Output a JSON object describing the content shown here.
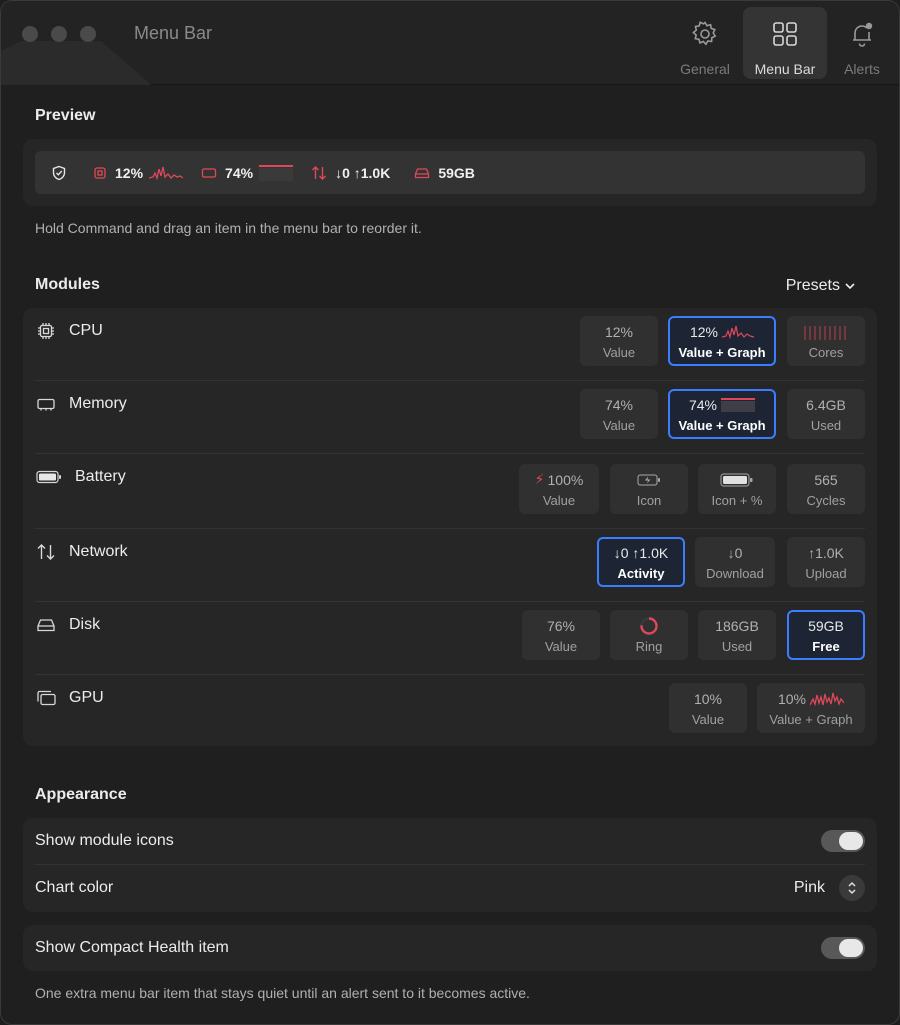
{
  "window": {
    "title": "Menu Bar"
  },
  "toolbar": {
    "tabs": [
      {
        "label": "General",
        "icon": "gear-icon"
      },
      {
        "label": "Menu Bar",
        "icon": "grid-icon",
        "active": true
      },
      {
        "label": "Alerts",
        "icon": "bell-icon"
      }
    ]
  },
  "preview": {
    "title": "Preview",
    "cpu": "12%",
    "memory": "74%",
    "network": "↓0 ↑1.0K",
    "disk": "59GB",
    "hint": "Hold Command and drag an item in the menu bar to reorder it."
  },
  "modules": {
    "title": "Modules",
    "presets_label": "Presets",
    "rows": [
      {
        "name": "CPU",
        "icon": "cpu-icon",
        "options": [
          {
            "top": "12%",
            "bottom": "Value"
          },
          {
            "top": "12%",
            "bottom": "Value + Graph",
            "selected": true
          },
          {
            "top": "",
            "bottom": "Cores"
          }
        ]
      },
      {
        "name": "Memory",
        "icon": "memory-icon",
        "options": [
          {
            "top": "74%",
            "bottom": "Value"
          },
          {
            "top": "74%",
            "bottom": "Value + Graph",
            "selected": true
          },
          {
            "top": "6.4GB",
            "bottom": "Used"
          }
        ]
      },
      {
        "name": "Battery",
        "icon": "battery-icon",
        "options": [
          {
            "top": "100%",
            "bottom": "Value"
          },
          {
            "top": "",
            "bottom": "Icon"
          },
          {
            "top": "",
            "bottom": "Icon + %"
          },
          {
            "top": "565",
            "bottom": "Cycles"
          }
        ]
      },
      {
        "name": "Network",
        "icon": "network-icon",
        "options": [
          {
            "top": "↓0 ↑1.0K",
            "bottom": "Activity",
            "selected": true
          },
          {
            "top": "↓0",
            "bottom": "Download"
          },
          {
            "top": "↑1.0K",
            "bottom": "Upload"
          }
        ]
      },
      {
        "name": "Disk",
        "icon": "disk-icon",
        "options": [
          {
            "top": "76%",
            "bottom": "Value"
          },
          {
            "top": "",
            "bottom": "Ring"
          },
          {
            "top": "186GB",
            "bottom": "Used"
          },
          {
            "top": "59GB",
            "bottom": "Free",
            "selected": true
          }
        ]
      },
      {
        "name": "GPU",
        "icon": "gpu-icon",
        "options": [
          {
            "top": "10%",
            "bottom": "Value"
          },
          {
            "top": "10%",
            "bottom": "Value + Graph"
          }
        ]
      }
    ]
  },
  "appearance": {
    "title": "Appearance",
    "show_icons_label": "Show module icons",
    "show_icons_on": true,
    "chart_color_label": "Chart color",
    "chart_color_value": "Pink",
    "compact_label": "Show Compact Health item",
    "compact_on": true,
    "compact_hint": "One extra menu bar item that stays quiet until an alert sent to it becomes active."
  },
  "colors": {
    "accent": "#3a7dff",
    "chart": "#e0485a"
  }
}
